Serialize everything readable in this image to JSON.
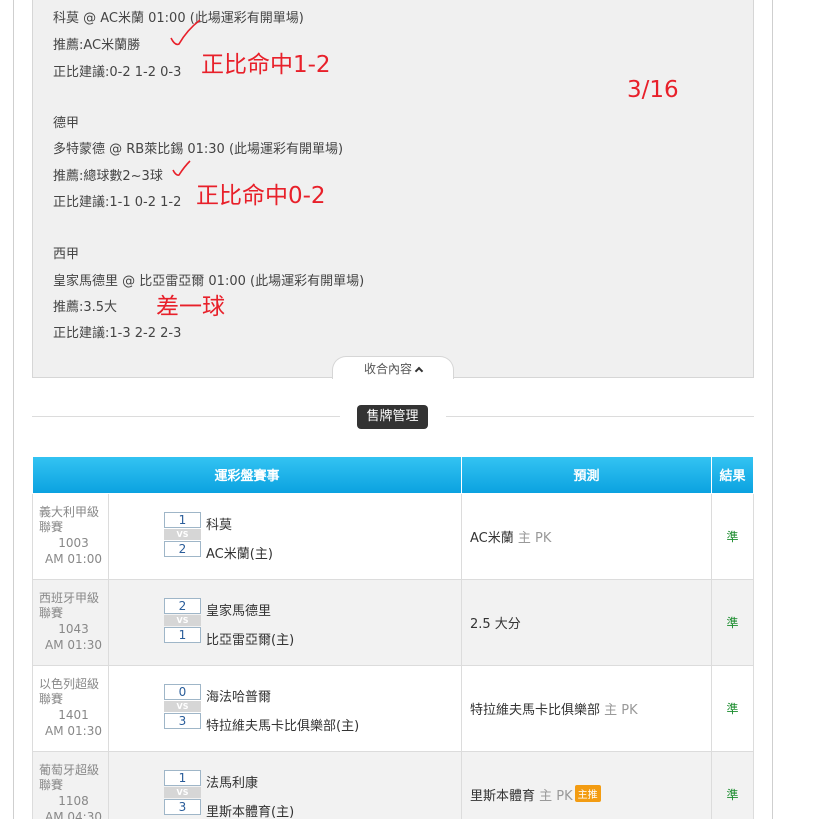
{
  "article": {
    "lines": [
      "科莫 @ AC米蘭 01:00 (此場運彩有開單場)",
      "推薦:AC米蘭勝",
      "正比建議:0-2 1-2 0-3",
      "德甲",
      "多特蒙德 @ RB萊比錫 01:30 (此場運彩有開單場)",
      "推薦:總球數2~3球",
      "正比建議:1-1 0-2 1-2",
      "西甲",
      "皇家馬德里 @ 比亞雷亞爾 01:00 (此場運彩有開單場)",
      "推薦:3.5大",
      "正比建議:1-3 2-2 2-3"
    ],
    "handwritten_notes": [
      "正比命中1-2",
      "3/16",
      "正比命中0-2",
      "差一球"
    ],
    "collapse_label": "收合內容"
  },
  "section_pill": "售牌管理",
  "table": {
    "headers": [
      "運彩盤賽事",
      "預測",
      "結果"
    ],
    "vs_label": "VS",
    "rows": [
      {
        "league": "義大利甲級聯賽",
        "code": "1003",
        "time": "AM 01:00",
        "score1": "1",
        "team1": "科莫",
        "score2": "2",
        "team2": "AC米蘭(主)",
        "pred_main": "AC米蘭",
        "pred_extra": " 主 PK",
        "badge": "",
        "result": "準"
      },
      {
        "league": "西班牙甲級聯賽",
        "code": "1043",
        "time": "AM 01:30",
        "score1": "2",
        "team1": "皇家馬德里",
        "score2": "1",
        "team2": "比亞雷亞爾(主)",
        "pred_main": "2.5 大分",
        "pred_extra": "",
        "badge": "",
        "result": "準"
      },
      {
        "league": "以色列超級聯賽",
        "code": "1401",
        "time": "AM 01:30",
        "score1": "0",
        "team1": "海法哈普爾",
        "score2": "3",
        "team2": "特拉維夫馬卡比俱樂部(主)",
        "pred_main": "特拉維夫馬卡比俱樂部",
        "pred_extra": " 主 PK",
        "badge": "",
        "result": "準"
      },
      {
        "league": "葡萄牙超級聯賽",
        "code": "1108",
        "time": "AM 04:30",
        "score1": "1",
        "team1": "法馬利康",
        "score2": "3",
        "team2": "里斯本體育(主)",
        "pred_main": "里斯本體育",
        "pred_extra": " 主 PK",
        "badge": "主推",
        "result": "準"
      }
    ]
  }
}
